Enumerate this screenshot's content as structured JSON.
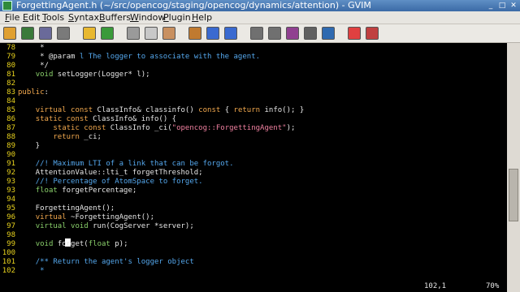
{
  "window": {
    "title": "ForgettingAgent.h (~/src/opencog/staging/opencog/dynamics/attention) - GVIM",
    "buttons": [
      "_",
      "□",
      "✕"
    ]
  },
  "menu": [
    {
      "accel": "F",
      "rest": "ile"
    },
    {
      "accel": "E",
      "rest": "dit"
    },
    {
      "accel": "T",
      "rest": "ools"
    },
    {
      "accel": "S",
      "rest": "yntax"
    },
    {
      "accel": "B",
      "rest": "uffers"
    },
    {
      "accel": "W",
      "rest": "indow"
    },
    {
      "accel": "P",
      "rest": "lugin"
    },
    {
      "accel": "H",
      "rest": "elp"
    }
  ],
  "toolbar": [
    {
      "name": "open-icon",
      "color": "#e0a030"
    },
    {
      "name": "save-icon",
      "color": "#3a7a3a"
    },
    {
      "name": "save-all-icon",
      "color": "#6a6a9a"
    },
    {
      "name": "print-icon",
      "color": "#7a7a7a"
    },
    {
      "name": "undo-icon",
      "color": "#e8b830"
    },
    {
      "name": "redo-icon",
      "color": "#3a9a3a"
    },
    {
      "name": "cut-icon",
      "color": "#9a9a9a"
    },
    {
      "name": "copy-icon",
      "color": "#c8c8c8"
    },
    {
      "name": "paste-icon",
      "color": "#c89060"
    },
    {
      "name": "load-session-icon",
      "color": "#c07a30"
    },
    {
      "name": "forward-icon",
      "color": "#3a6ad0"
    },
    {
      "name": "back-icon",
      "color": "#3a6ad0"
    },
    {
      "name": "run-script-icon",
      "color": "#707070"
    },
    {
      "name": "make-icon",
      "color": "#707070"
    },
    {
      "name": "build-tags-icon",
      "color": "#904090"
    },
    {
      "name": "shell-icon",
      "color": "#606060"
    },
    {
      "name": "jump-tag-icon",
      "color": "#2f6ab0"
    },
    {
      "name": "help-icon",
      "color": "#e04040"
    },
    {
      "name": "find-help-icon",
      "color": "#c04040"
    }
  ],
  "editor": {
    "lines": [
      {
        "n": "78",
        "segs": [
          {
            "t": "     * "
          },
          {
            "t": "",
            "c": "cm"
          }
        ]
      },
      {
        "n": "79",
        "segs": [
          {
            "t": "     * @param "
          },
          {
            "t": "l The logger to associate with the agent.",
            "c": "cm"
          }
        ]
      },
      {
        "n": "80",
        "segs": [
          {
            "t": "     */"
          }
        ]
      },
      {
        "n": "81",
        "segs": [
          {
            "t": "    "
          },
          {
            "t": "void",
            "c": "ty"
          },
          {
            "t": " setLogger(Logger* l);"
          }
        ]
      },
      {
        "n": "82",
        "segs": [
          {
            "t": ""
          }
        ]
      },
      {
        "n": "83",
        "segs": [
          {
            "t": "public",
            "c": "kw"
          },
          {
            "t": ":"
          }
        ]
      },
      {
        "n": "84",
        "segs": [
          {
            "t": ""
          }
        ]
      },
      {
        "n": "85",
        "segs": [
          {
            "t": "    "
          },
          {
            "t": "virtual const",
            "c": "kw"
          },
          {
            "t": " ClassInfo& classinfo() "
          },
          {
            "t": "const",
            "c": "kw"
          },
          {
            "t": " { "
          },
          {
            "t": "return",
            "c": "kw"
          },
          {
            "t": " info(); }"
          }
        ]
      },
      {
        "n": "86",
        "segs": [
          {
            "t": "    "
          },
          {
            "t": "static const",
            "c": "kw"
          },
          {
            "t": " ClassInfo& info() {"
          }
        ]
      },
      {
        "n": "87",
        "segs": [
          {
            "t": "        "
          },
          {
            "t": "static const",
            "c": "kw"
          },
          {
            "t": " ClassInfo _ci("
          },
          {
            "t": "\"opencog::ForgettingAgent\"",
            "c": "st"
          },
          {
            "t": ");"
          }
        ]
      },
      {
        "n": "88",
        "segs": [
          {
            "t": "        "
          },
          {
            "t": "return",
            "c": "kw"
          },
          {
            "t": " _ci;"
          }
        ]
      },
      {
        "n": "89",
        "segs": [
          {
            "t": "    }"
          }
        ]
      },
      {
        "n": "90",
        "segs": [
          {
            "t": ""
          }
        ]
      },
      {
        "n": "91",
        "segs": [
          {
            "t": "    "
          },
          {
            "t": "//! Maximum LTI of a link that can be forgot.",
            "c": "cm"
          }
        ]
      },
      {
        "n": "92",
        "segs": [
          {
            "t": "    AttentionValue::lti_t forgetThreshold;"
          }
        ]
      },
      {
        "n": "93",
        "segs": [
          {
            "t": "    "
          },
          {
            "t": "//! Percentage of AtomSpace to forget.",
            "c": "cm"
          }
        ]
      },
      {
        "n": "93",
        "segs": [
          {
            "t": "    "
          },
          {
            "t": "float",
            "c": "ty"
          },
          {
            "t": " forgetPercentage;"
          }
        ]
      },
      {
        "n": "94",
        "segs": [
          {
            "t": ""
          }
        ]
      },
      {
        "n": "95",
        "segs": [
          {
            "t": "    ForgettingAgent();"
          }
        ]
      },
      {
        "n": "96",
        "segs": [
          {
            "t": "    "
          },
          {
            "t": "virtual",
            "c": "kw"
          },
          {
            "t": " ~ForgettingAgent();"
          }
        ]
      },
      {
        "n": "97",
        "segs": [
          {
            "t": "    "
          },
          {
            "t": "virtual void",
            "c": "ty"
          },
          {
            "t": " run(CogServer *server);"
          }
        ]
      },
      {
        "n": "98",
        "segs": [
          {
            "t": ""
          }
        ]
      },
      {
        "n": "99",
        "segs": [
          {
            "t": "    "
          },
          {
            "t": "void",
            "c": "ty"
          },
          {
            "t": " forget("
          },
          {
            "t": "float",
            "c": "ty"
          },
          {
            "t": " p);"
          }
        ]
      },
      {
        "n": "100",
        "segs": [
          {
            "t": ""
          }
        ]
      },
      {
        "n": "101",
        "segs": [
          {
            "t": "    "
          },
          {
            "t": "/** Return the agent's logger object",
            "c": "cm"
          }
        ]
      },
      {
        "n": "102",
        "segs": [
          {
            "t": "     *",
            "c": "cm"
          }
        ]
      }
    ],
    "cursor_color": "#ffffff"
  },
  "status": {
    "position": "102,1",
    "percent": "70%"
  }
}
